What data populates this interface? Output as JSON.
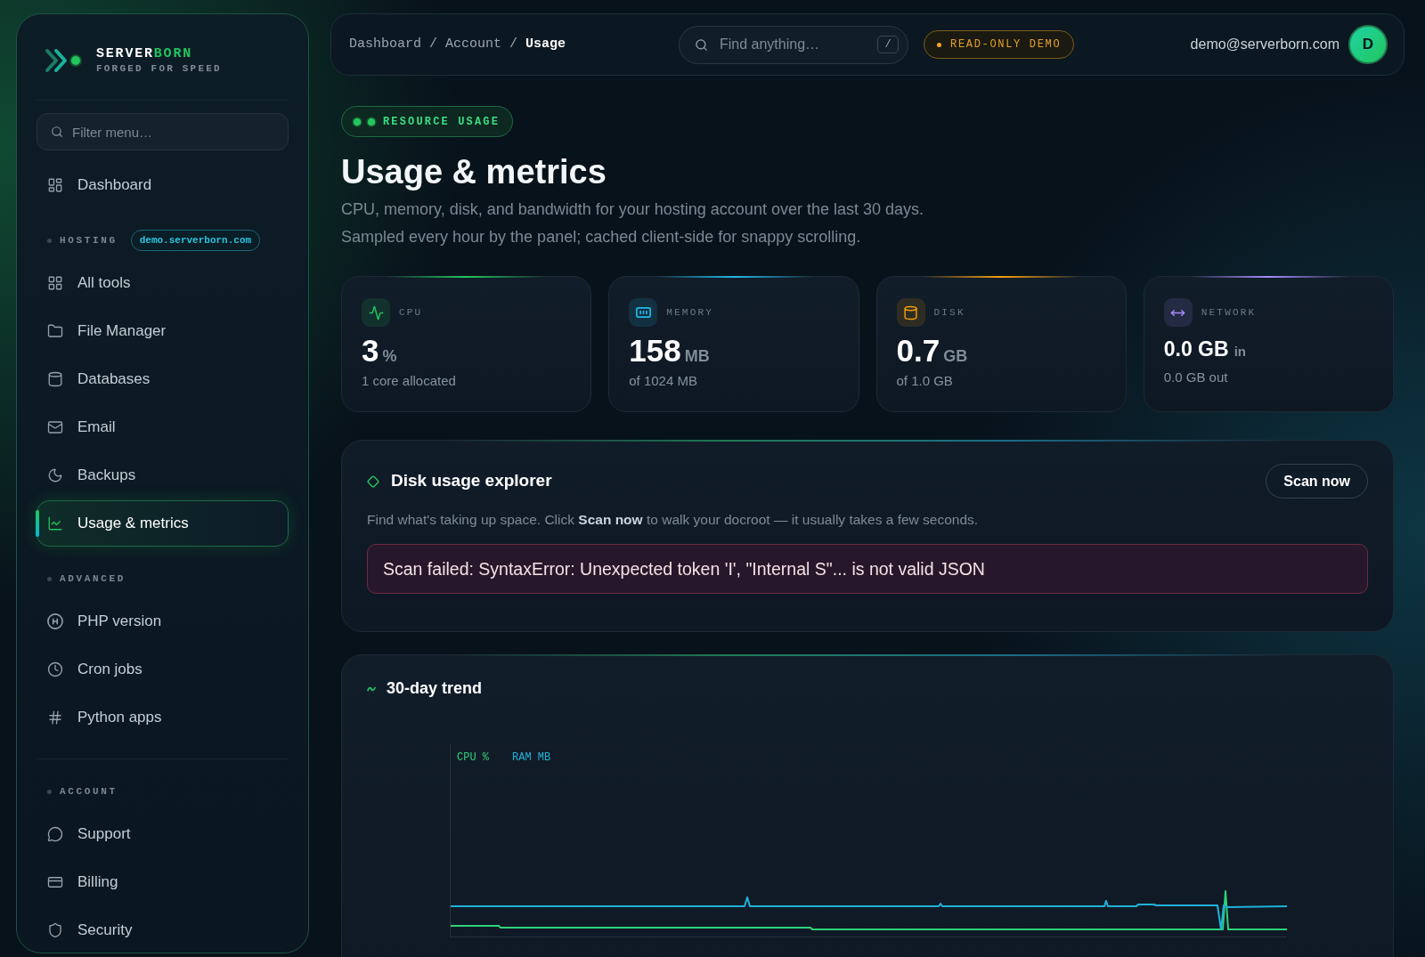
{
  "brand": {
    "name": "SERVER",
    "name_accent": "BORN",
    "tagline": "FORGED FOR SPEED"
  },
  "sidebar": {
    "filter": {
      "placeholder": "Filter menu…"
    },
    "groups": [
      {
        "sections": [
          {
            "items": [
              {
                "label": "Dashboard",
                "selected": false
              }
            ]
          },
          {
            "heading": "HOSTING",
            "tag": "demo.serverborn.com",
            "items": [
              {
                "label": "All tools",
                "selected": false
              },
              {
                "label": "File Manager",
                "selected": false
              },
              {
                "label": "Databases",
                "selected": false
              },
              {
                "label": "Email",
                "selected": false
              },
              {
                "label": "Backups",
                "selected": false
              },
              {
                "label": "Usage & metrics",
                "selected": true
              }
            ]
          },
          {
            "heading": "ADVANCED",
            "items": [
              {
                "label": "PHP version",
                "selected": false
              },
              {
                "label": "Cron jobs",
                "selected": false
              },
              {
                "label": "Python apps",
                "selected": false
              }
            ]
          }
        ]
      },
      {
        "sections": [
          {
            "heading": "ACCOUNT",
            "items": [
              {
                "label": "Support",
                "selected": false
              },
              {
                "label": "Billing",
                "selected": false
              },
              {
                "label": "Security",
                "selected": false
              }
            ]
          }
        ]
      }
    ]
  },
  "header": {
    "breadcrumb": [
      {
        "label": "Dashboard",
        "current": false,
        "separator": "/"
      },
      {
        "label": "Account",
        "current": false,
        "separator": "/"
      },
      {
        "label": "Usage",
        "current": true
      }
    ],
    "search": {
      "placeholder": "Find anything…",
      "shortcut": "/"
    },
    "mode_badge": "READ-ONLY DEMO",
    "user": {
      "email": "demo@serverborn.com",
      "initial": "D"
    }
  },
  "page": {
    "eyebrow": "RESOURCE USAGE",
    "title": "Usage & metrics",
    "description": [
      "CPU, memory, disk, and bandwidth for your hosting account over the last 30 days.",
      "Sampled every hour by the panel; cached client-side for snappy scrolling."
    ]
  },
  "stats": [
    {
      "kind": "gauge",
      "label": "CPU",
      "value": "3",
      "unit": "%",
      "detail": "1 core allocated",
      "color": "#22c55e"
    },
    {
      "kind": "gauge",
      "label": "MEMORY",
      "value": "158",
      "unit": "MB",
      "detail": "of 1024 MB",
      "color": "#22b8e6"
    },
    {
      "kind": "gauge",
      "label": "DISK",
      "value": "0.7",
      "unit": "GB",
      "detail": "of 1.0 GB",
      "color": "#f59e0b"
    },
    {
      "kind": "traffic",
      "label": "NETWORK",
      "value": "0.0 GB",
      "unit": "in",
      "detail": "0.0 GB out",
      "color": "#a78bfa"
    }
  ],
  "disk_explorer": {
    "title": "Disk usage explorer",
    "button": "Scan now",
    "description": "Find what's taking up space. Click **Scan now** to walk your docroot — it usually takes a few seconds.",
    "error": "Scan failed: SyntaxError: Unexpected token 'I', \"Internal S\"... is not valid JSON"
  },
  "trend": {
    "title": "30-day trend",
    "legend": [
      {
        "label": "CPU %",
        "color": "#2fd27a"
      },
      {
        "label": "RAM MB",
        "color": "#1fb2d8"
      }
    ]
  }
}
